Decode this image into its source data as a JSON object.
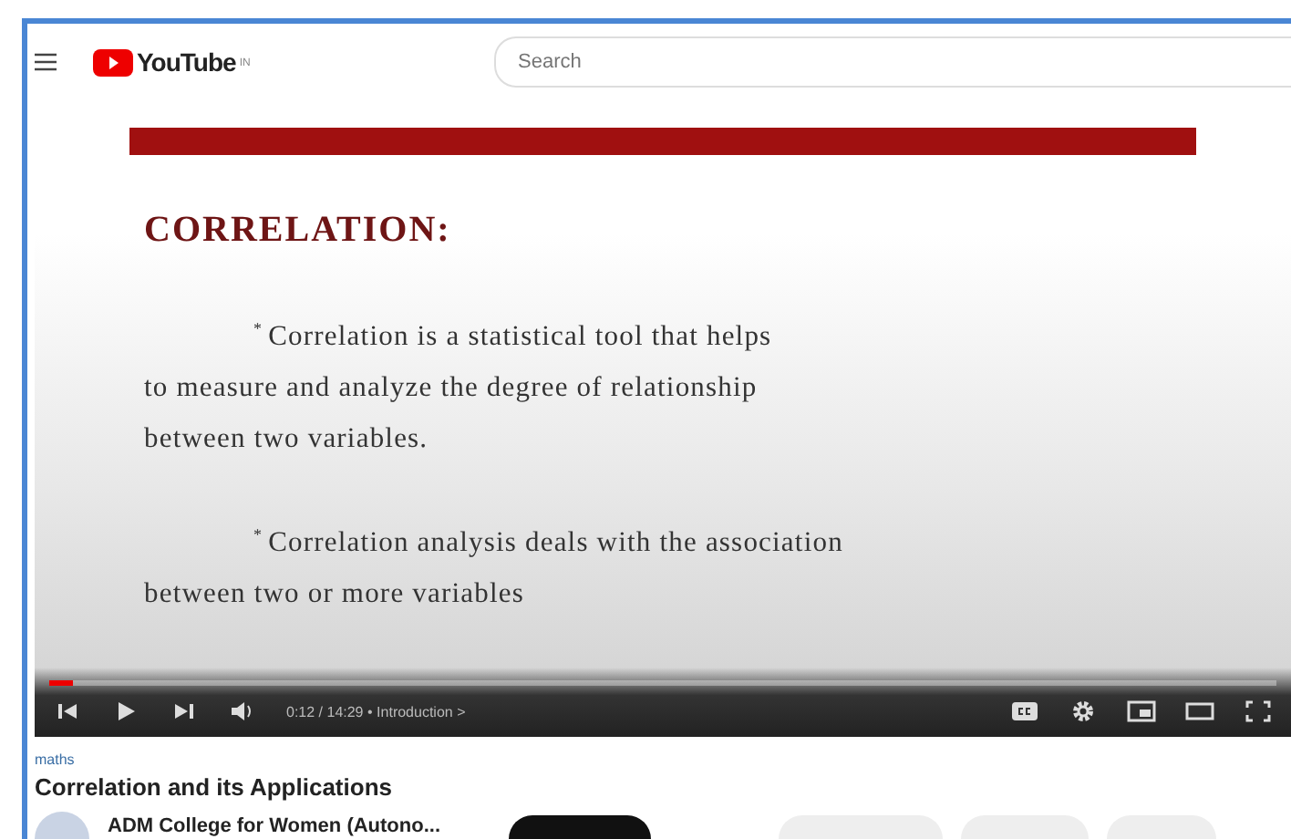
{
  "header": {
    "logo": "YouTube",
    "region": "IN",
    "search": {
      "placeholder": "Search"
    }
  },
  "slide": {
    "title": "CORRELATION:",
    "paragraphs": [
      {
        "bullet": "*",
        "lines": [
          "Correlation is a statistical tool that  helps",
          "to measure  and analyze the degree of relationship",
          "between two variables."
        ]
      },
      {
        "bullet": "*",
        "lines": [
          "Correlation analysis deals with the association",
          "between two or more variables"
        ]
      }
    ]
  },
  "player": {
    "level": 0.02,
    "time": "0:12 / 14:29",
    "separator": "•",
    "chapter": "Introduction >"
  },
  "video": {
    "tag": "maths",
    "title": "Correlation and its Applications",
    "channel": "ADM College for Women (Autono..."
  }
}
